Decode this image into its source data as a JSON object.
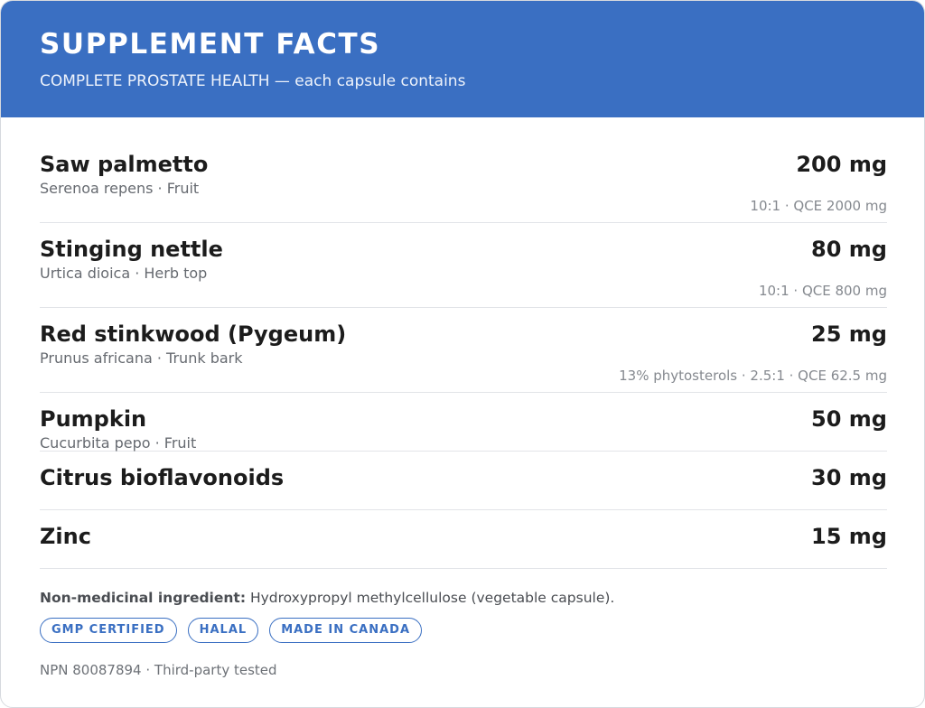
{
  "header": {
    "title": "SUPPLEMENT FACTS",
    "subtitle": "COMPLETE PROSTATE HEALTH — each capsule contains"
  },
  "ingredients": [
    {
      "name": "Saw palmetto",
      "amount": "200 mg",
      "latin": "Serenoa repens · Fruit",
      "spec": "10:1 · QCE 2000 mg"
    },
    {
      "name": "Stinging nettle",
      "amount": "80 mg",
      "latin": "Urtica dioica · Herb top",
      "spec": "10:1 · QCE 800 mg"
    },
    {
      "name": "Red stinkwood (Pygeum)",
      "amount": "25 mg",
      "latin": "Prunus africana · Trunk bark",
      "spec": "13% phytosterols · 2.5:1 · QCE 62.5 mg"
    },
    {
      "name": "Pumpkin",
      "amount": "50 mg",
      "latin": "Cucurbita pepo · Fruit"
    },
    {
      "name": "Citrus bioflavonoids",
      "amount": "30 mg"
    },
    {
      "name": "Zinc",
      "amount": "15 mg"
    }
  ],
  "non_medicinal": {
    "label": "Non-medicinal ingredient:",
    "text": " Hydroxypropyl methylcellulose (vegetable capsule)."
  },
  "badges": [
    "GMP CERTIFIED",
    "HALAL",
    "MADE IN CANADA"
  ],
  "footer": "NPN 80087894 · Third-party tested",
  "colors": {
    "brand": "#3a6fc2",
    "header_text": "#ffffff"
  }
}
